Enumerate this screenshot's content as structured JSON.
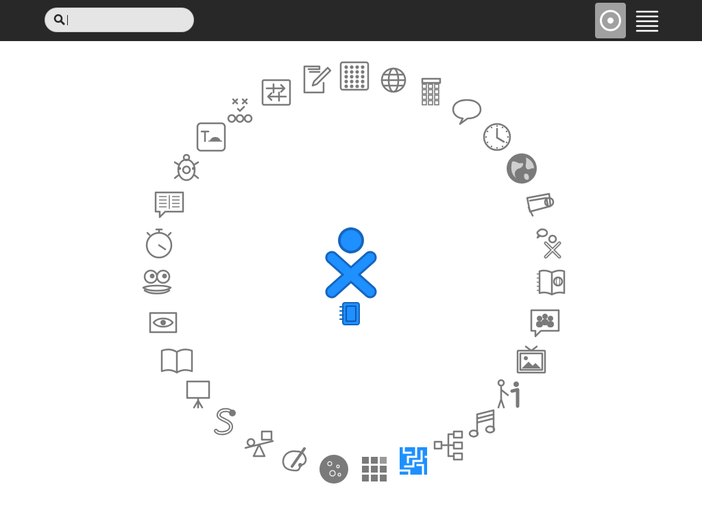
{
  "toolbar": {
    "search": {
      "value": "",
      "placeholder": ""
    },
    "buttons": [
      {
        "name": "favorites-view-button",
        "icon": "view-radial-icon",
        "selected": true
      },
      {
        "name": "list-view-button",
        "icon": "view-list-icon",
        "selected": false
      }
    ]
  },
  "home": {
    "center_icon": "xo-icon",
    "journal_icon": "journal-icon",
    "accent_color": "#1e88e5",
    "icon_color": "#7a7a7a",
    "activities": [
      {
        "name": "abacus",
        "icon": "abacus-icon"
      },
      {
        "name": "browse",
        "icon": "globe-icon"
      },
      {
        "name": "calculate",
        "icon": "calculator-icon"
      },
      {
        "name": "chat",
        "icon": "speech-bubble-icon"
      },
      {
        "name": "clock",
        "icon": "clock-icon"
      },
      {
        "name": "world-map",
        "icon": "earth-icon"
      },
      {
        "name": "imageviewer",
        "icon": "photo-search-icon"
      },
      {
        "name": "speak",
        "icon": "speak-icon"
      },
      {
        "name": "read-etexts",
        "icon": "world-book-icon"
      },
      {
        "name": "social-help",
        "icon": "community-chat-icon"
      },
      {
        "name": "photo-frame",
        "icon": "picture-frame-icon"
      },
      {
        "name": "help",
        "icon": "help-person-icon"
      },
      {
        "name": "music-keyboard",
        "icon": "music-note-icon"
      },
      {
        "name": "labyrinth",
        "icon": "mind-map-icon"
      },
      {
        "name": "maze",
        "icon": "maze-icon",
        "selected": true
      },
      {
        "name": "implode",
        "icon": "grid-blocks-icon"
      },
      {
        "name": "moon",
        "icon": "moon-icon"
      },
      {
        "name": "paint",
        "icon": "paint-palette-icon"
      },
      {
        "name": "physics",
        "icon": "seesaw-icon"
      },
      {
        "name": "pippy",
        "icon": "snake-icon"
      },
      {
        "name": "presentation",
        "icon": "presentation-board-icon"
      },
      {
        "name": "read",
        "icon": "open-book-icon"
      },
      {
        "name": "record",
        "icon": "camera-eye-icon"
      },
      {
        "name": "jukebox",
        "icon": "eyes-face-icon"
      },
      {
        "name": "stopwatch",
        "icon": "stopwatch-icon"
      },
      {
        "name": "story",
        "icon": "newspaper-bubble-icon"
      },
      {
        "name": "turtle-blocks",
        "icon": "turtle-icon"
      },
      {
        "name": "typing-turtle",
        "icon": "typing-turtle-icon"
      },
      {
        "name": "tictactoe",
        "icon": "tictactoe-icon"
      },
      {
        "name": "image-transfer",
        "icon": "transfer-arrows-icon"
      },
      {
        "name": "write",
        "icon": "pencil-document-icon"
      }
    ]
  }
}
